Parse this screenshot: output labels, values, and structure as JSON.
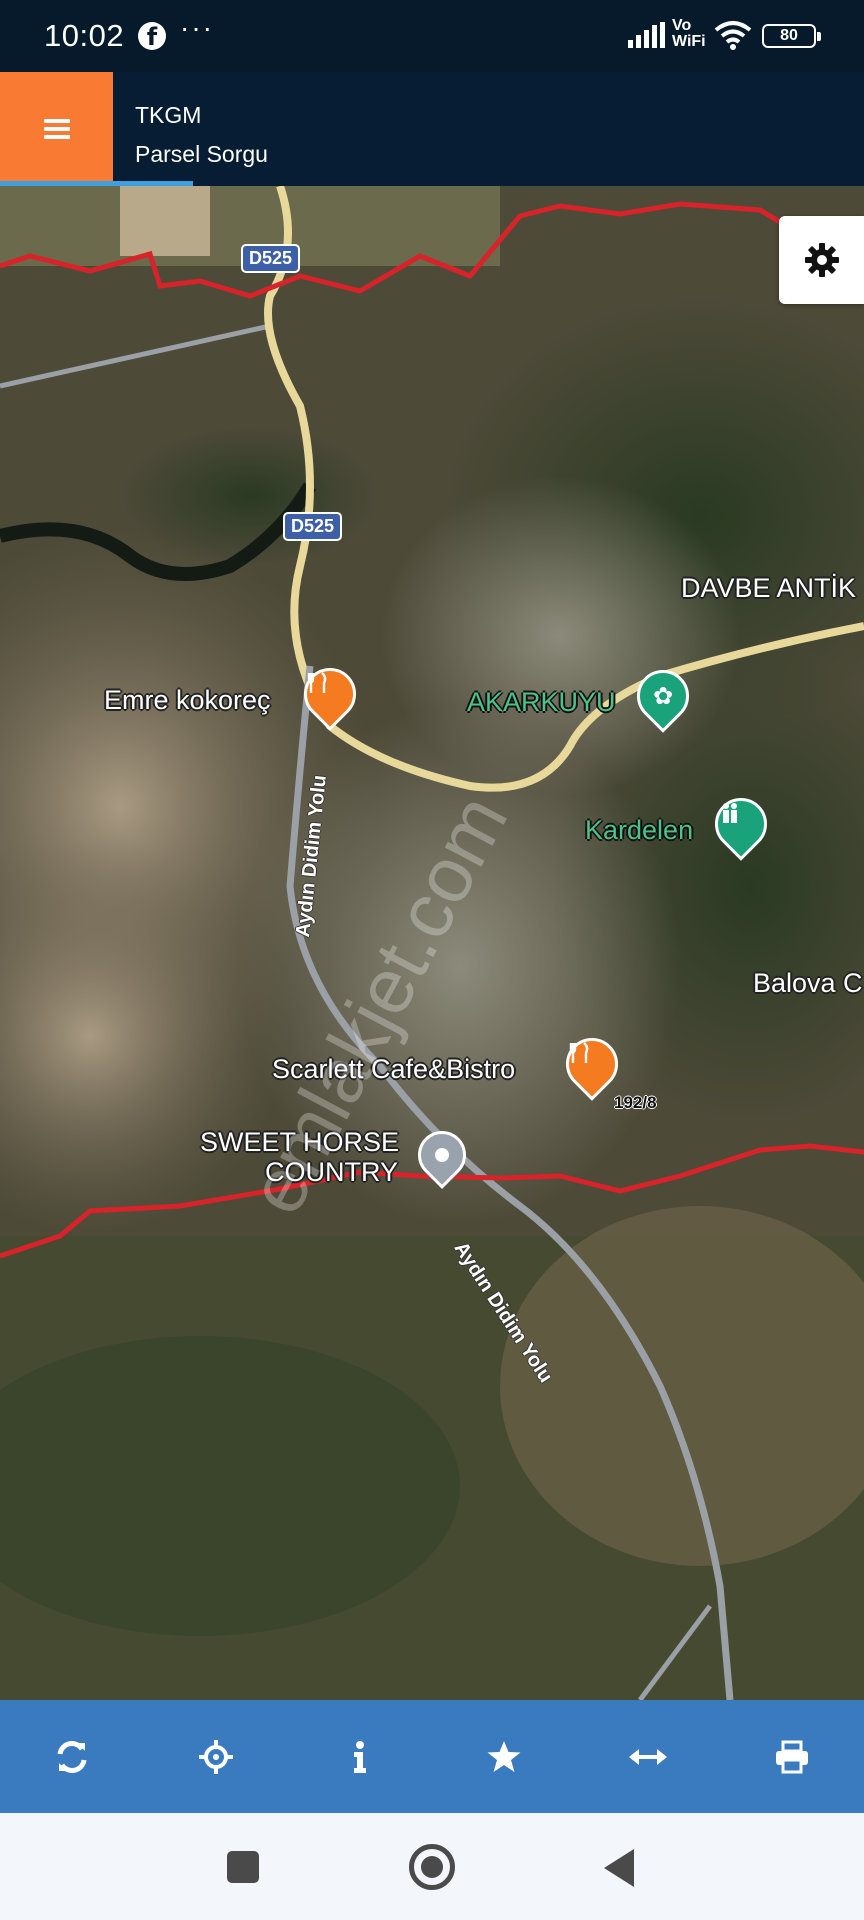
{
  "status_bar": {
    "time": "10:02",
    "facebook_glyph": "f",
    "more_glyph": "···",
    "vowifi_line1": "Vo",
    "vowifi_line2": "WiFi",
    "battery": "80"
  },
  "app_bar": {
    "menu_icon": "hamburger-menu-icon",
    "title": "TKGM",
    "subtitle": "Parsel Sorgu",
    "accent_color": "#f97a33",
    "background_color": "#071d33"
  },
  "map": {
    "road_shields": [
      "D525",
      "D525"
    ],
    "road_names": [
      "Aydın Didim Yolu",
      "Aydın Didim Yolu"
    ],
    "places": {
      "emre": "Emre kokoreç",
      "akarkuyu": "AKARKUYU",
      "davbe": "DAVBE ANTİK",
      "kardelen": "Kardelen",
      "balova": "Balova C",
      "scarlett": "Scarlett Cafe&Bistro",
      "sweet_horse_1": "SWEET HORSE",
      "sweet_horse_2": "COUNTRY"
    },
    "parcel_label": "192/8",
    "watermark": "emlakjet.com",
    "boundary_color": "#d8232a"
  },
  "settings": {
    "icon": "gear-icon"
  },
  "toolbar": {
    "background_color": "#3a7bbf",
    "buttons": [
      "refresh-icon",
      "locate-crosshair-icon",
      "info-icon",
      "star-icon",
      "measure-arrows-icon",
      "print-icon"
    ]
  },
  "nav_bar": {
    "buttons": [
      "recents-square",
      "home-circle",
      "back-triangle"
    ]
  }
}
